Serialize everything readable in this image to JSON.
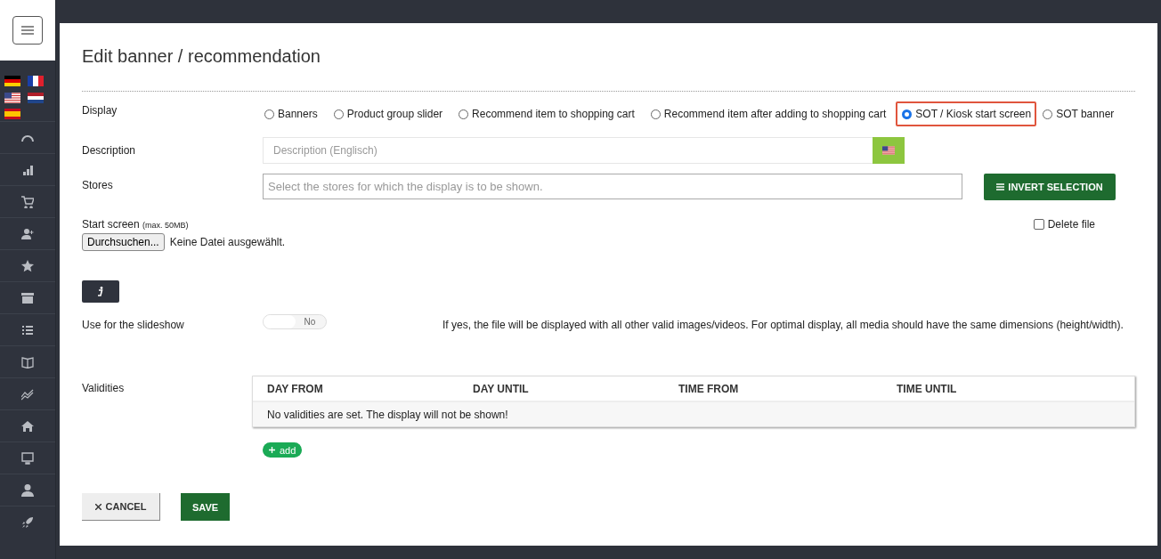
{
  "title": "Edit banner / recommendation",
  "display": {
    "label": "Display",
    "options": [
      {
        "label": "Banners",
        "selected": false,
        "highlighted": false
      },
      {
        "label": "Product group slider",
        "selected": false,
        "highlighted": false
      },
      {
        "label": "Recommend item to shopping cart",
        "selected": false,
        "highlighted": false
      },
      {
        "label": "Recommend item after adding to shopping cart",
        "selected": false,
        "highlighted": false
      },
      {
        "label": "SOT / Kiosk start screen",
        "selected": true,
        "highlighted": true
      },
      {
        "label": "SOT banner",
        "selected": false,
        "highlighted": false
      }
    ]
  },
  "description": {
    "label": "Description",
    "placeholder": "Description (Englisch)"
  },
  "stores": {
    "label": "Stores",
    "placeholder": "Select the stores for which the display is to be shown.",
    "button": "INVERT SELECTION"
  },
  "start_screen": {
    "label": "Start screen",
    "hint": "(max. 50MB)",
    "browse_button": "Durchsuchen...",
    "file_status": "Keine Datei ausgewählt.",
    "delete_file": {
      "label": "Delete file",
      "checked": false
    }
  },
  "slideshow": {
    "label": "Use for the slideshow",
    "on": false,
    "toggle_text": "No",
    "help": "If yes, the file will be displayed with all other valid images/videos. For optimal display, all media should have the same dimensions (height/width)."
  },
  "validities": {
    "label": "Validities",
    "columns": [
      "DAY FROM",
      "DAY UNTIL",
      "TIME FROM",
      "TIME UNTIL"
    ],
    "empty_message": "No validities are set. The display will not be shown!",
    "add_button": "add"
  },
  "buttons": {
    "cancel": "CANCEL",
    "save": "SAVE"
  }
}
